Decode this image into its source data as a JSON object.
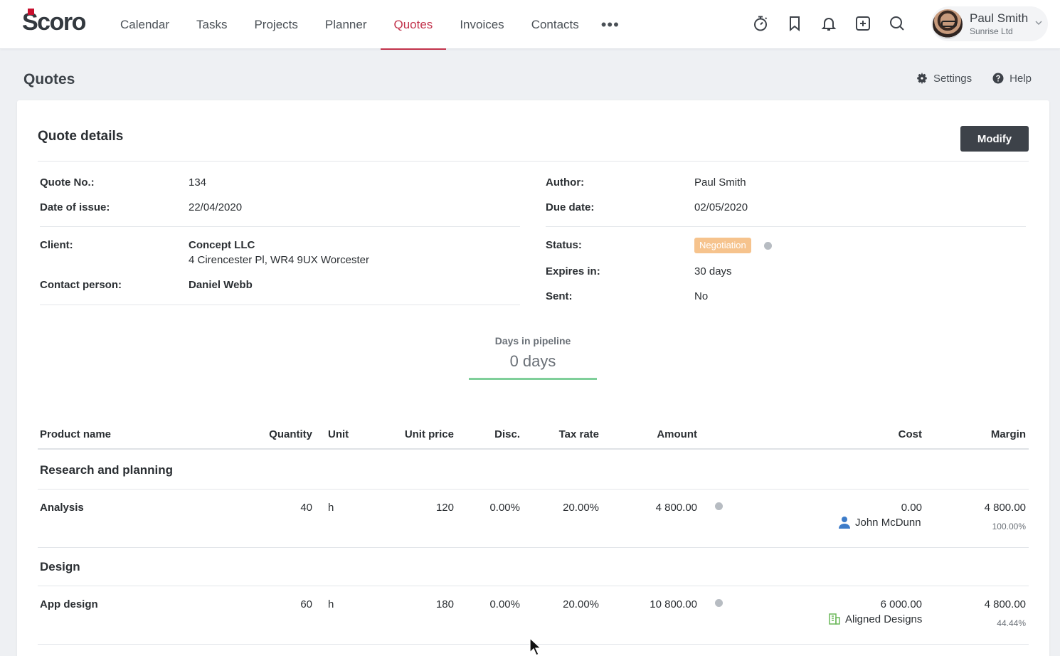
{
  "app": {
    "logo": "Scoro"
  },
  "nav": {
    "items": [
      {
        "label": "Calendar",
        "active": false
      },
      {
        "label": "Tasks",
        "active": false
      },
      {
        "label": "Projects",
        "active": false
      },
      {
        "label": "Planner",
        "active": false
      },
      {
        "label": "Quotes",
        "active": true
      },
      {
        "label": "Invoices",
        "active": false
      },
      {
        "label": "Contacts",
        "active": false
      }
    ],
    "more": "•••",
    "icons": [
      "timer-icon",
      "bookmark-icon",
      "bell-icon",
      "add-icon",
      "search-icon"
    ]
  },
  "user": {
    "name": "Paul Smith",
    "company": "Sunrise Ltd"
  },
  "page": {
    "title": "Quotes",
    "settings": "Settings",
    "help": "Help"
  },
  "quote": {
    "card_title": "Quote details",
    "modify_label": "Modify",
    "labels": {
      "quote_no": "Quote No.:",
      "date_of_issue": "Date of issue:",
      "client": "Client:",
      "contact_person": "Contact person:",
      "author": "Author:",
      "due_date": "Due date:",
      "status": "Status:",
      "expires_in": "Expires in:",
      "sent": "Sent:"
    },
    "values": {
      "quote_no": "134",
      "date_of_issue": "22/04/2020",
      "client_name": "Concept LLC",
      "client_address": "4 Cirencester Pl, WR4 9UX Worcester",
      "contact_person": "Daniel Webb",
      "author": "Paul Smith",
      "due_date": "02/05/2020",
      "status": "Negotiation",
      "expires_in": "30 days",
      "sent": "No"
    },
    "status_color": "#f6c38d",
    "pipeline": {
      "label": "Days in pipeline",
      "value": "0 days"
    }
  },
  "table": {
    "headers": {
      "product": "Product name",
      "quantity": "Quantity",
      "unit": "Unit",
      "unit_price": "Unit price",
      "disc": "Disc.",
      "tax": "Tax rate",
      "amount": "Amount",
      "cost": "Cost",
      "margin": "Margin"
    },
    "groups": [
      {
        "title": "Research and planning",
        "rows": [
          {
            "product": "Analysis",
            "quantity": "40",
            "unit": "h",
            "unit_price": "120",
            "disc": "0.00%",
            "tax": "20.00%",
            "amount": "4 800.00",
            "cost": "0.00",
            "assignee": "John McDunn",
            "assignee_icon": "person-icon",
            "margin": "4 800.00",
            "margin_pct": "100.00%"
          }
        ]
      },
      {
        "title": "Design",
        "rows": [
          {
            "product": "App design",
            "quantity": "60",
            "unit": "h",
            "unit_price": "180",
            "disc": "0.00%",
            "tax": "20.00%",
            "amount": "10 800.00",
            "cost": "6 000.00",
            "assignee": "Aligned Designs",
            "assignee_icon": "building-icon",
            "margin": "4 800.00",
            "margin_pct": "44.44%"
          }
        ]
      }
    ]
  }
}
